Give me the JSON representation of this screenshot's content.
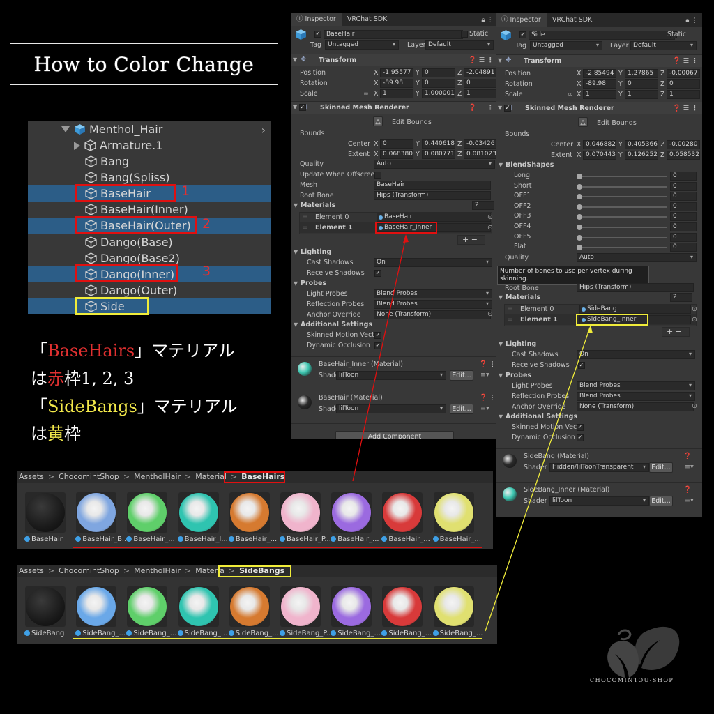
{
  "title": "How to Color Change",
  "hierarchy": {
    "items": [
      {
        "label": "Menthol_Hair",
        "root": true,
        "selected": false
      },
      {
        "label": "Armature.1",
        "expandable": true,
        "selected": false
      },
      {
        "label": "Bang",
        "selected": false
      },
      {
        "label": "Bang(Spliss)",
        "selected": false
      },
      {
        "label": "BaseHair",
        "selected": true
      },
      {
        "label": "BaseHair(Inner)",
        "selected": false
      },
      {
        "label": "BaseHair(Outer)",
        "selected": true
      },
      {
        "label": "Dango(Base)",
        "selected": false
      },
      {
        "label": "Dango(Base2)",
        "selected": false
      },
      {
        "label": "Dango(Inner)",
        "selected": true
      },
      {
        "label": "Dango(Outer)",
        "selected": false
      },
      {
        "label": "Side",
        "selected": true
      }
    ],
    "marks": [
      "1",
      "2",
      "3"
    ]
  },
  "note": {
    "line1_pre": "「",
    "line1_red": "BaseHairs",
    "line1_post": "」マテリアル",
    "line2_pre": "は",
    "line2_red": "赤",
    "line2_post": "枠1, 2, 3",
    "line3_pre": "「",
    "line3_yellow": "SideBangs",
    "line3_post": "」マテリアル",
    "line4_pre": "は",
    "line4_yellow": "黄",
    "line4_post": "枠"
  },
  "inspector_left": {
    "tabs": [
      "Inspector",
      "VRChat SDK"
    ],
    "object_name": "BaseHair",
    "static_label": "Static",
    "tag_label": "Tag",
    "tag_value": "Untagged",
    "layer_label": "Layer",
    "layer_value": "Default",
    "transform": "Transform",
    "position": {
      "label": "Position",
      "x": "-1.95577",
      "y": "0",
      "z": "-2.04891"
    },
    "rotation": {
      "label": "Rotation",
      "x": "-89.98",
      "y": "0",
      "z": "0"
    },
    "scale": {
      "label": "Scale",
      "x": "1",
      "y": "1.000001",
      "z": "1"
    },
    "smr": "Skinned Mesh Renderer",
    "edit_bounds": "Edit Bounds",
    "bounds": "Bounds",
    "center": {
      "label": "Center",
      "x": "0",
      "y": "0.440618",
      "z": "-0.03426"
    },
    "extent": {
      "label": "Extent",
      "x": "0.068380",
      "y": "0.080771",
      "z": "0.081023"
    },
    "quality": {
      "label": "Quality",
      "value": "Auto"
    },
    "update_offscreen": "Update When Offscreen",
    "mesh": {
      "label": "Mesh",
      "value": "BaseHair"
    },
    "root_bone": {
      "label": "Root Bone",
      "value": "Hips (Transform)"
    },
    "materials": {
      "label": "Materials",
      "count": "2"
    },
    "element0": {
      "label": "Element 0",
      "value": "BaseHair"
    },
    "element1": {
      "label": "Element 1",
      "value": "BaseHair_Inner"
    },
    "lighting": "Lighting",
    "cast_shadows": {
      "label": "Cast Shadows",
      "value": "On"
    },
    "receive_shadows": "Receive Shadows",
    "probes": "Probes",
    "light_probes": {
      "label": "Light Probes",
      "value": "Blend Probes"
    },
    "reflection_probes": {
      "label": "Reflection Probes",
      "value": "Blend Probes"
    },
    "anchor_override": {
      "label": "Anchor Override",
      "value": "None (Transform)"
    },
    "additional": "Additional Settings",
    "skinned_motion": "Skinned Motion Vecto",
    "dynamic_occlusion": "Dynamic Occlusion",
    "mat1": {
      "name": "BaseHair_Inner (Material)",
      "shader_label": "Shader",
      "shader": "lilToon",
      "edit": "Edit..."
    },
    "mat2": {
      "name": "BaseHair (Material)",
      "shader_label": "Shader",
      "shader": "lilToon",
      "edit": "Edit..."
    },
    "add_component": "Add Component"
  },
  "inspector_right": {
    "tabs": [
      "Inspector",
      "VRChat SDK"
    ],
    "object_name": "Side",
    "static_label": "Static",
    "tag_label": "Tag",
    "tag_value": "Untagged",
    "layer_label": "Layer",
    "layer_value": "Default",
    "transform": "Transform",
    "position": {
      "label": "Position",
      "x": "-2.85494",
      "y": "1.27865",
      "z": "-0.00067"
    },
    "rotation": {
      "label": "Rotation",
      "x": "-89.98",
      "y": "0",
      "z": "0"
    },
    "scale": {
      "label": "Scale",
      "x": "1",
      "y": "1",
      "z": "1"
    },
    "smr": "Skinned Mesh Renderer",
    "edit_bounds": "Edit Bounds",
    "bounds": "Bounds",
    "center": {
      "label": "Center",
      "x": "0.046882",
      "y": "0.405366",
      "z": "-0.00280"
    },
    "extent": {
      "label": "Extent",
      "x": "0.070443",
      "y": "0.126252",
      "z": "0.058532"
    },
    "blendshapes": "BlendShapes",
    "shapes": [
      {
        "label": "Long",
        "value": "0"
      },
      {
        "label": "Short",
        "value": "0"
      },
      {
        "label": "OFF1",
        "value": "0"
      },
      {
        "label": "OFF2",
        "value": "0"
      },
      {
        "label": "OFF3",
        "value": "0"
      },
      {
        "label": "OFF4",
        "value": "0"
      },
      {
        "label": "OFF5",
        "value": "0"
      },
      {
        "label": "Flat",
        "value": "0"
      }
    ],
    "quality": {
      "label": "Quality",
      "value": "Auto"
    },
    "tooltip": "Number of bones to use per vertex during skinning.",
    "root_bone": {
      "label": "Root Bone",
      "value": "Hips (Transform)"
    },
    "materials": {
      "label": "Materials",
      "count": "2"
    },
    "element0": {
      "label": "Element 0",
      "value": "SideBang"
    },
    "element1": {
      "label": "Element 1",
      "value": "SideBang_Inner"
    },
    "lighting": "Lighting",
    "cast_shadows": {
      "label": "Cast Shadows",
      "value": "On"
    },
    "receive_shadows": "Receive Shadows",
    "probes": "Probes",
    "light_probes": {
      "label": "Light Probes",
      "value": "Blend Probes"
    },
    "reflection_probes": {
      "label": "Reflection Probes",
      "value": "Blend Probes"
    },
    "anchor_override": {
      "label": "Anchor Override",
      "value": "None (Transform)"
    },
    "additional": "Additional Settings",
    "skinned_motion": "Skinned Motion Vecto",
    "dynamic_occlusion": "Dynamic Occlusion",
    "mat1": {
      "name": "SideBang (Material)",
      "shader_label": "Shader",
      "shader": "Hidden/lilToonTransparent",
      "edit": "Edit..."
    },
    "mat2": {
      "name": "SideBang_Inner (Material)",
      "shader_label": "Shader",
      "shader": "lilToon",
      "edit": "Edit..."
    }
  },
  "assets_basehairs": {
    "breadcrumb": [
      "Assets",
      "ChocomintShop",
      "MentholHair",
      "Material"
    ],
    "folder": "BaseHairs",
    "items": [
      {
        "label": "BaseHair",
        "color": "#202020"
      },
      {
        "label": "BaseHair_B...",
        "color": "#7fa6e0"
      },
      {
        "label": "BaseHair_...",
        "color": "#5fcf6a"
      },
      {
        "label": "BaseHair_l...",
        "color": "#2fc4b0"
      },
      {
        "label": "BaseHair_...",
        "color": "#d67a30"
      },
      {
        "label": "BaseHair_P...",
        "color": "#f0b4cc"
      },
      {
        "label": "BaseHair_...",
        "color": "#9b6ae0"
      },
      {
        "label": "BaseHair_...",
        "color": "#d83a3a"
      },
      {
        "label": "BaseHair_...",
        "color": "#e0e070"
      }
    ]
  },
  "assets_sidebangs": {
    "breadcrumb": [
      "Assets",
      "ChocomintShop",
      "MentholHair",
      "Materia"
    ],
    "folder": "SideBangs",
    "items": [
      {
        "label": "SideBang",
        "color": "#202020"
      },
      {
        "label": "SideBang_...",
        "color": "#6aa8e8"
      },
      {
        "label": "SideBang_...",
        "color": "#5fcf6a"
      },
      {
        "label": "SideBang_...",
        "color": "#2fc4b0"
      },
      {
        "label": "SideBang_...",
        "color": "#d67a30"
      },
      {
        "label": "SideBang_P...",
        "color": "#f0b4cc"
      },
      {
        "label": "SideBang_...",
        "color": "#9b6ae0"
      },
      {
        "label": "SideBang_...",
        "color": "#d83a3a"
      },
      {
        "label": "SideBang_...",
        "color": "#e0e070"
      }
    ]
  },
  "logo_text": "CHOCOMINTOU-SHOP",
  "colors": {
    "red": "#e01010",
    "yellow": "#f0ec3a",
    "selection": "#2c5d87",
    "panel": "#383838"
  }
}
